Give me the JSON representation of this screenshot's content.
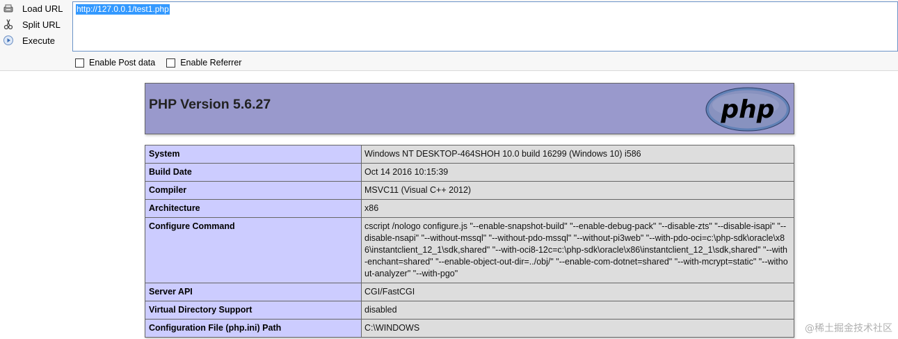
{
  "hackbar": {
    "actions": [
      {
        "label": "Load URL",
        "icon": "load-url-icon"
      },
      {
        "label": "Split URL",
        "icon": "scissors-icon"
      },
      {
        "label": "Execute",
        "icon": "play-icon"
      }
    ],
    "url_value": "http://127.0.0.1/test1.php",
    "options": [
      {
        "label": "Enable Post data",
        "checked": false
      },
      {
        "label": "Enable Referrer",
        "checked": false
      }
    ]
  },
  "phpinfo": {
    "title": "PHP Version 5.6.27",
    "logo_text": "php",
    "rows": [
      {
        "key": "System",
        "value": "Windows NT DESKTOP-464SHOH 10.0 build 16299 (Windows 10) i586"
      },
      {
        "key": "Build Date",
        "value": "Oct 14 2016 10:15:39"
      },
      {
        "key": "Compiler",
        "value": "MSVC11 (Visual C++ 2012)"
      },
      {
        "key": "Architecture",
        "value": "x86"
      },
      {
        "key": "Configure Command",
        "value": "cscript /nologo configure.js \"--enable-snapshot-build\" \"--enable-debug-pack\" \"--disable-zts\" \"--disable-isapi\" \"--disable-nsapi\" \"--without-mssql\" \"--without-pdo-mssql\" \"--without-pi3web\" \"--with-pdo-oci=c:\\php-sdk\\oracle\\x86\\instantclient_12_1\\sdk,shared\" \"--with-oci8-12c=c:\\php-sdk\\oracle\\x86\\instantclient_12_1\\sdk,shared\" \"--with-enchant=shared\" \"--enable-object-out-dir=../obj/\" \"--enable-com-dotnet=shared\" \"--with-mcrypt=static\" \"--without-analyzer\" \"--with-pgo\""
      },
      {
        "key": "Server API",
        "value": "CGI/FastCGI"
      },
      {
        "key": "Virtual Directory Support",
        "value": "disabled"
      },
      {
        "key": "Configuration File (php.ini) Path",
        "value": "C:\\WINDOWS"
      }
    ]
  },
  "watermark": "@稀土掘金技术社区",
  "colors": {
    "header_bg": "#9999cc",
    "key_bg": "#ccccff",
    "value_bg": "#dddddd",
    "url_selection": "#3399ff"
  }
}
